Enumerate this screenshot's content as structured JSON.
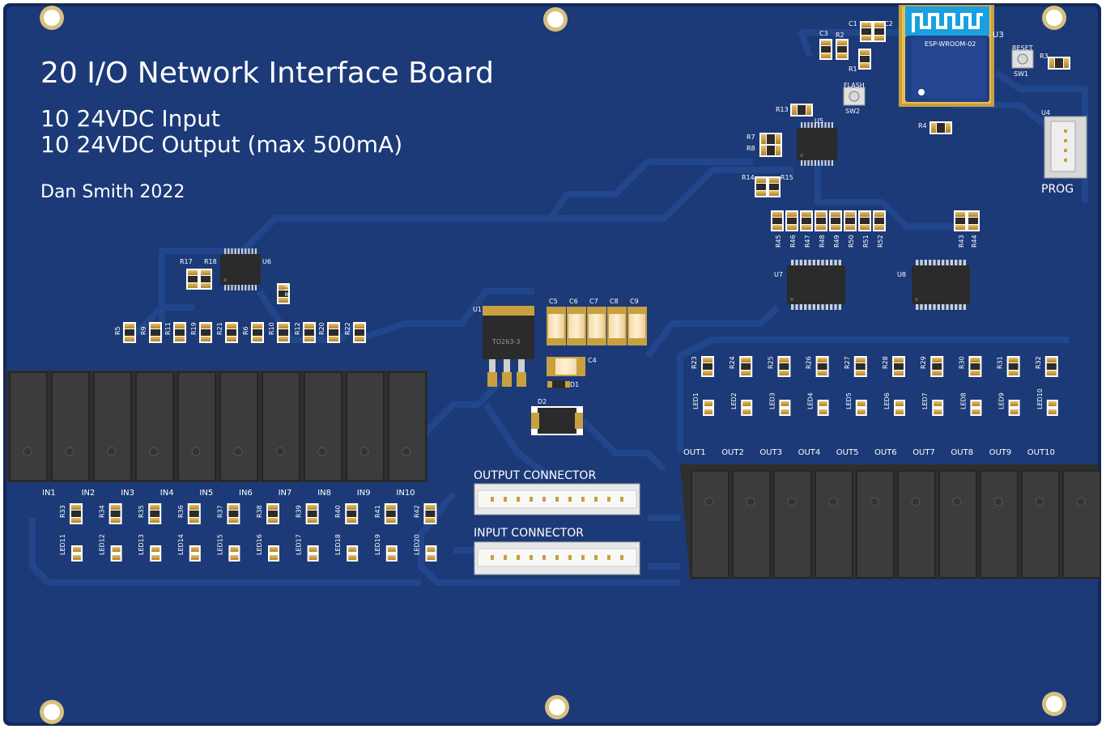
{
  "board": {
    "title": "20 I/O Network Interface Board",
    "subtitle_line1": "10 24VDC Input",
    "subtitle_line2": "10 24VDC Output (max 500mA)",
    "author": "Dan Smith 2022",
    "colors": {
      "pcb": "#1c3a78",
      "trace": "#22468c",
      "edge": "#14285a",
      "silkscreen": "#ffffff",
      "relay": "#3a3a3a",
      "gold": "#c8a040",
      "chip": "#2b2b2b",
      "wifi_module": "#1aa0e0"
    }
  },
  "esp": {
    "ref": "U3",
    "part": "ESP-WROOM-02",
    "caps": [
      "C1",
      "C2",
      "C3"
    ],
    "res": [
      "R2",
      "R1",
      "R3",
      "R4",
      "R13"
    ]
  },
  "buttons": {
    "reset": {
      "label": "RESET",
      "ref": "SW1"
    },
    "flash": {
      "label": "FLASH",
      "ref": "SW2"
    }
  },
  "prog": {
    "ref": "U4",
    "label": "PROG"
  },
  "u5": {
    "ref": "U5",
    "res": [
      "R7",
      "R8",
      "R14",
      "R15"
    ]
  },
  "top_res": [
    "R45",
    "R46",
    "R47",
    "R48",
    "R49",
    "R50",
    "R51",
    "R52"
  ],
  "r43_44": [
    "R43",
    "R44"
  ],
  "u7": "U7",
  "u8": "U8",
  "u6": {
    "ref": "U6",
    "res": [
      "R17",
      "R18",
      "R16"
    ]
  },
  "input_res_top": [
    "R5",
    "R9",
    "R11",
    "R19",
    "R21",
    "R6",
    "R10",
    "R12",
    "R20",
    "R22"
  ],
  "power": {
    "u1_ref": "U1",
    "u1_pkg": "TO263-3",
    "caps": [
      "C5",
      "C6",
      "C7",
      "C8",
      "C9"
    ],
    "c4": "C4",
    "d1": "D1",
    "d2": "D2"
  },
  "connectors": {
    "output": "OUTPUT  CONNECTOR",
    "input": "INPUT  CONNECTOR"
  },
  "input_labels": [
    "IN1",
    "IN2",
    "IN3",
    "IN4",
    "IN5",
    "IN6",
    "IN7",
    "IN8",
    "IN9",
    "IN10"
  ],
  "input_res": [
    "R33",
    "R34",
    "R35",
    "R36",
    "R37",
    "R38",
    "R39",
    "R40",
    "R41",
    "R42"
  ],
  "input_leds": [
    "LED11",
    "LED12",
    "LED13",
    "LED14",
    "LED15",
    "LED16",
    "LED17",
    "LED18",
    "LED19",
    "LED20"
  ],
  "output_labels": [
    "OUT1",
    "OUT2",
    "OUT3",
    "OUT4",
    "OUT5",
    "OUT6",
    "OUT7",
    "OUT8",
    "OUT9",
    "OUT10"
  ],
  "output_res": [
    "R23",
    "R24",
    "R25",
    "R26",
    "R27",
    "R28",
    "R29",
    "R30",
    "R31",
    "R32"
  ],
  "output_leds": [
    "LED1",
    "LED2",
    "LED3",
    "LED4",
    "LED5",
    "LED6",
    "LED7",
    "LED8",
    "LED9",
    "LED10"
  ]
}
